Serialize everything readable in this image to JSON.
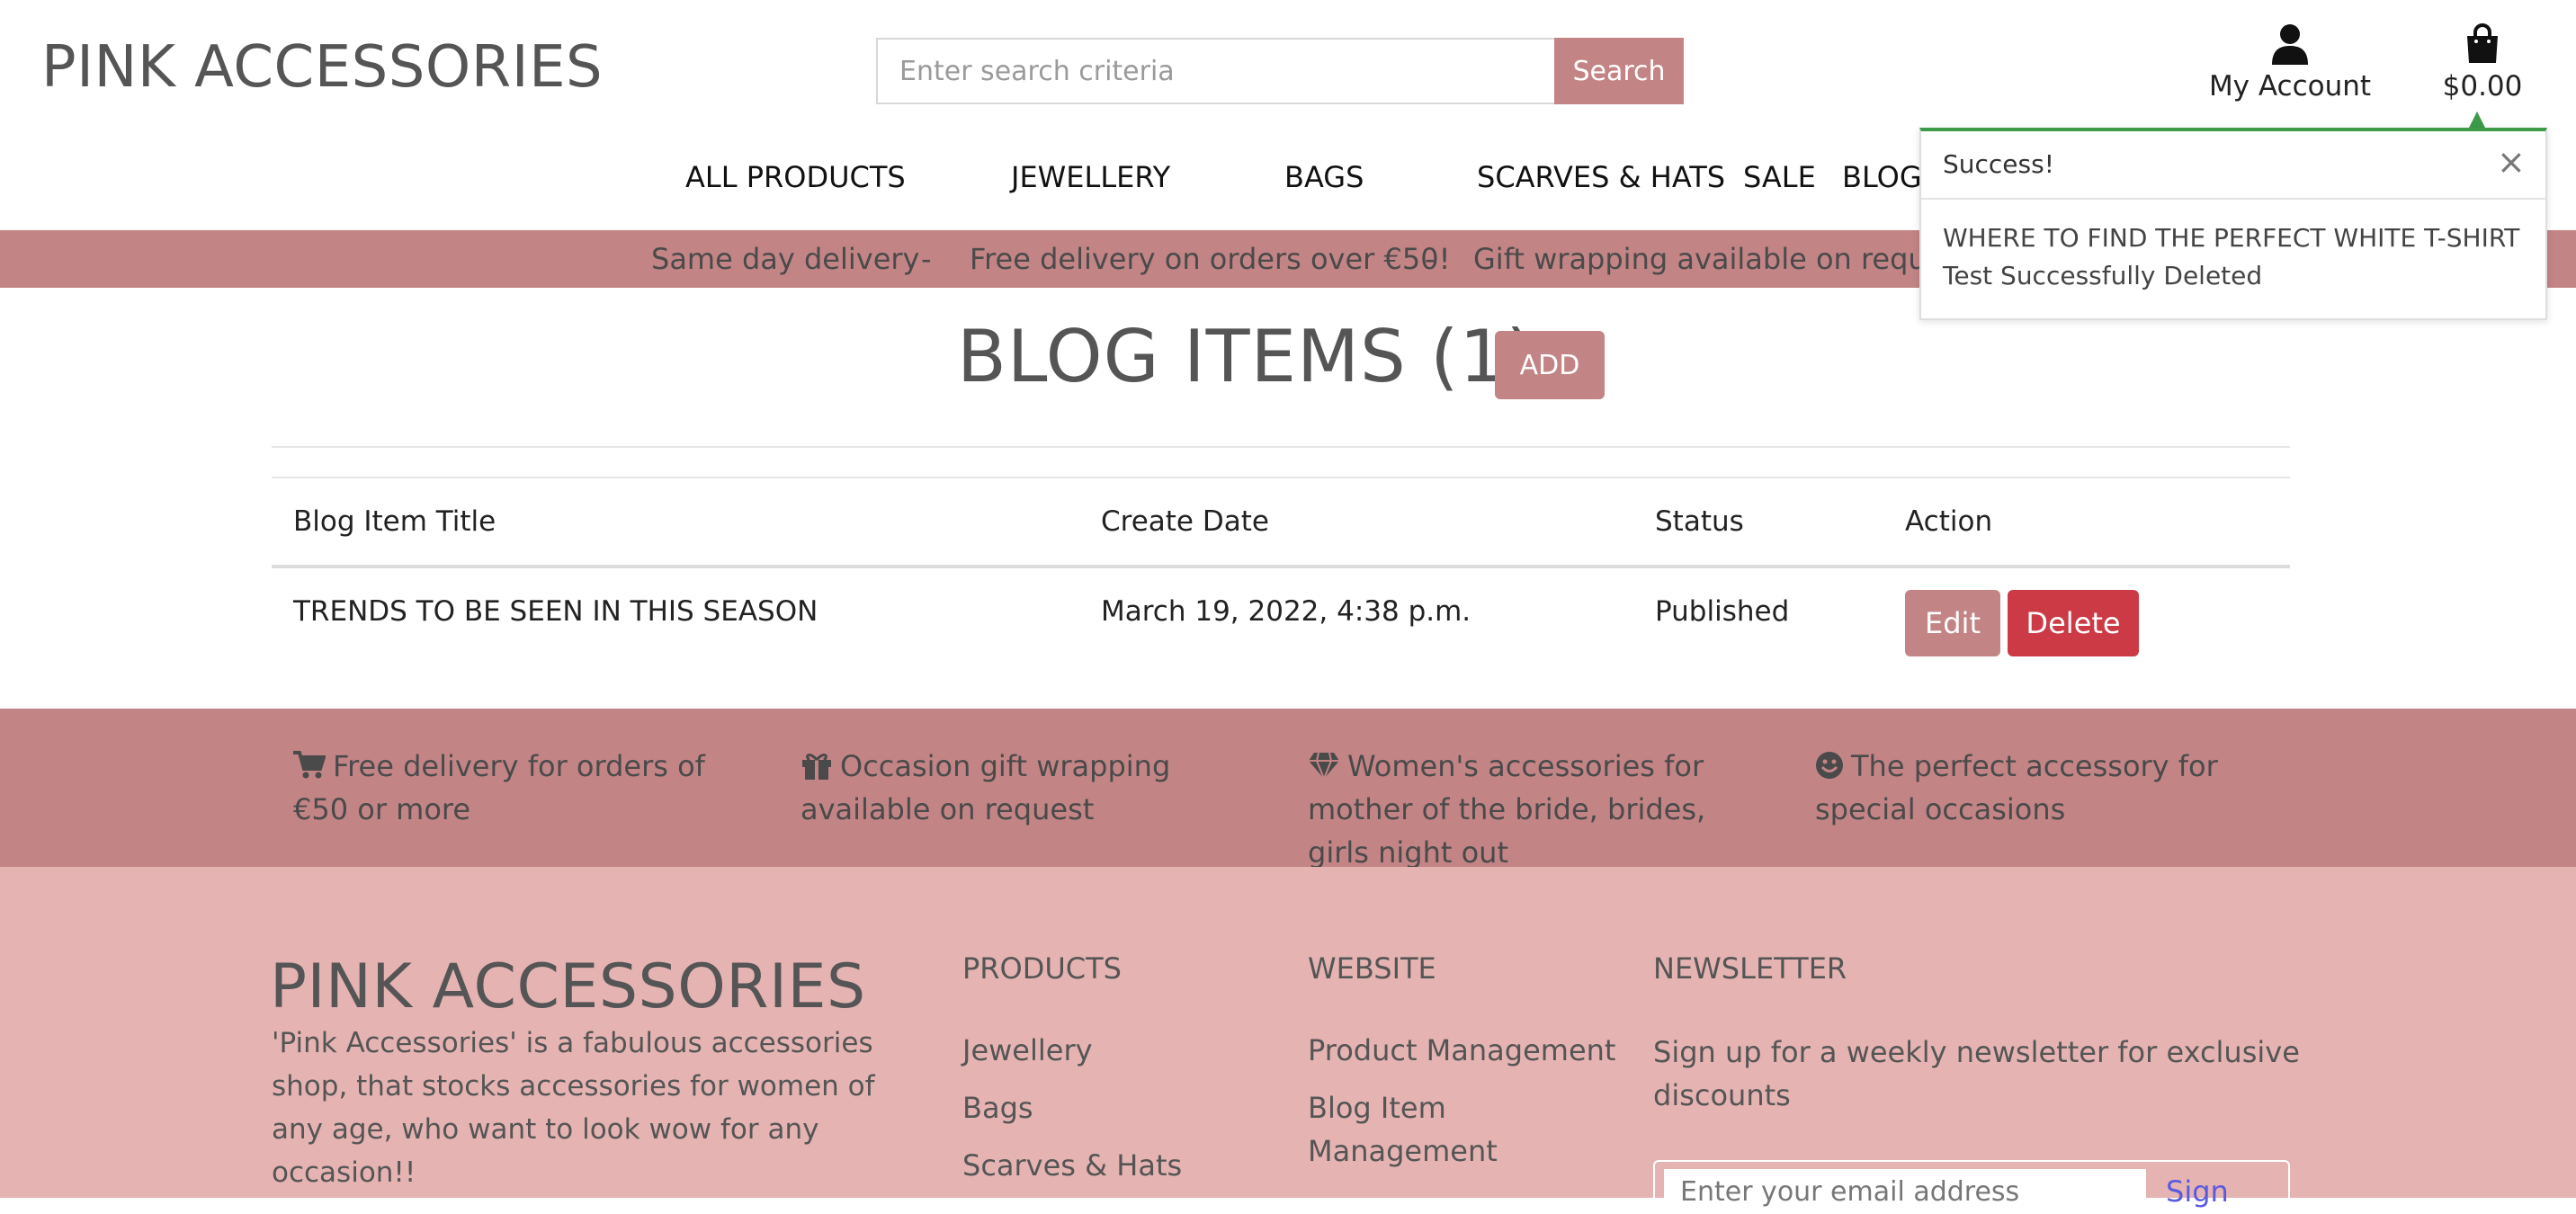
{
  "header": {
    "logo": "PINK ACCESSORIES",
    "search": {
      "placeholder": "Enter search criteria",
      "value": "",
      "button": "Search"
    },
    "account_label": "My Account",
    "cart_total": "$0.00"
  },
  "nav": {
    "items": [
      "ALL PRODUCTS",
      "JEWELLERY",
      "BAGS",
      "SCARVES & HATS",
      "SALE",
      "BLOG"
    ]
  },
  "delivery_strip": {
    "items": [
      "Same day delivery",
      "Free delivery on orders over €50!",
      "Gift wrapping available on request"
    ],
    "separator": "-"
  },
  "blog": {
    "title": "BLOG ITEMS (1)",
    "add_button": "ADD",
    "columns": [
      "Blog Item Title",
      "Create Date",
      "Status",
      "Action"
    ],
    "rows": [
      {
        "title": "TRENDS TO BE SEEN IN THIS SEASON",
        "date": "March 19, 2022, 4:38 p.m.",
        "status": "Published",
        "edit": "Edit",
        "delete": "Delete"
      }
    ]
  },
  "features": [
    {
      "icon": "cart-icon",
      "text": "Free delivery for orders of €50 or more"
    },
    {
      "icon": "gift-icon",
      "text": "Occasion gift wrapping available on request"
    },
    {
      "icon": "gem-icon",
      "text": "Women's accessories for mother of the bride, brides, girls night out"
    },
    {
      "icon": "smile-icon",
      "text": "The perfect accessory for special occasions"
    }
  ],
  "footer": {
    "logo": "PINK ACCESSORIES",
    "description": "'Pink Accessories' is a fabulous accessories shop, that stocks accessories for women of any age, who want to look wow for any occasion!!",
    "products_heading": "PRODUCTS",
    "products_links": [
      "Jewellery",
      "Bags",
      "Scarves & Hats"
    ],
    "website_heading": "WEBSITE",
    "website_links": [
      "Product Management",
      "Blog Item Management"
    ],
    "newsletter_heading": "NEWSLETTER",
    "newsletter_text": "Sign up for a weekly newsletter for exclusive discounts",
    "newsletter_placeholder": "Enter your email address",
    "newsletter_button": "Sign"
  },
  "toast": {
    "title": "Success!",
    "close": "×",
    "item_name": "WHERE TO FIND THE PERFECT WHITE T-SHIRT",
    "message": "Test Successfully Deleted"
  },
  "colors": {
    "accent": "#c38486",
    "danger": "#cc3a46",
    "footer_bg": "#e5b4b2",
    "success": "#3c9a49"
  }
}
